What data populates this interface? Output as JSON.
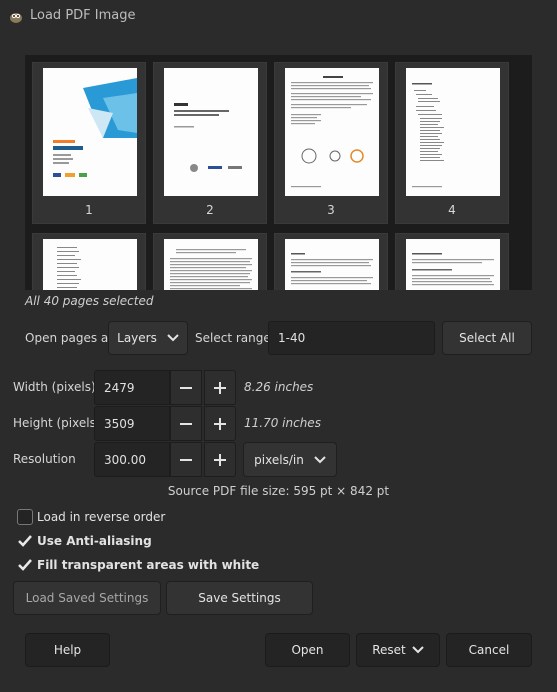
{
  "window": {
    "title": "Load PDF Image",
    "icon": "gimp-icon"
  },
  "preview": {
    "pages": [
      {
        "number": "1",
        "kind": "cover"
      },
      {
        "number": "2",
        "kind": "title"
      },
      {
        "number": "3",
        "kind": "text-figures"
      },
      {
        "number": "4",
        "kind": "toc"
      },
      {
        "number": "",
        "kind": "toc"
      },
      {
        "number": "",
        "kind": "text"
      },
      {
        "number": "",
        "kind": "text"
      },
      {
        "number": "",
        "kind": "text"
      }
    ],
    "selection_status": "All 40 pages selected"
  },
  "open_pages": {
    "label": "Open pages as",
    "value": "Layers",
    "range_label": "Select range:",
    "range_value": "1-40",
    "select_all": "Select All"
  },
  "width": {
    "label": "Width (pixels)",
    "value": "2479",
    "inches": "8.26 inches"
  },
  "height": {
    "label": "Height (pixels)",
    "value": "3509",
    "inches": "11.70 inches"
  },
  "resolution": {
    "label": "Resolution",
    "value": "300.00",
    "unit": "pixels/in"
  },
  "source_size": "Source PDF file size: 595 pt × 842 pt",
  "options": [
    {
      "label": "Load in reverse order",
      "checked": false
    },
    {
      "label": "Use Anti-aliasing",
      "checked": true
    },
    {
      "label": "Fill transparent areas with white",
      "checked": true
    }
  ],
  "settings_buttons": {
    "load": "Load Saved Settings",
    "save": "Save Settings"
  },
  "footer": {
    "help": "Help",
    "open": "Open",
    "reset": "Reset",
    "cancel": "Cancel"
  },
  "colors": {
    "background": "#2b2b2b",
    "thumb_background": "#1c1c1c",
    "button": "#333333",
    "entry": "#242424",
    "text": "#d6d6d6"
  },
  "icons": {
    "minus": "minus-icon",
    "plus": "plus-icon",
    "dropdown": "chevron-down-icon",
    "check": "check-icon"
  }
}
